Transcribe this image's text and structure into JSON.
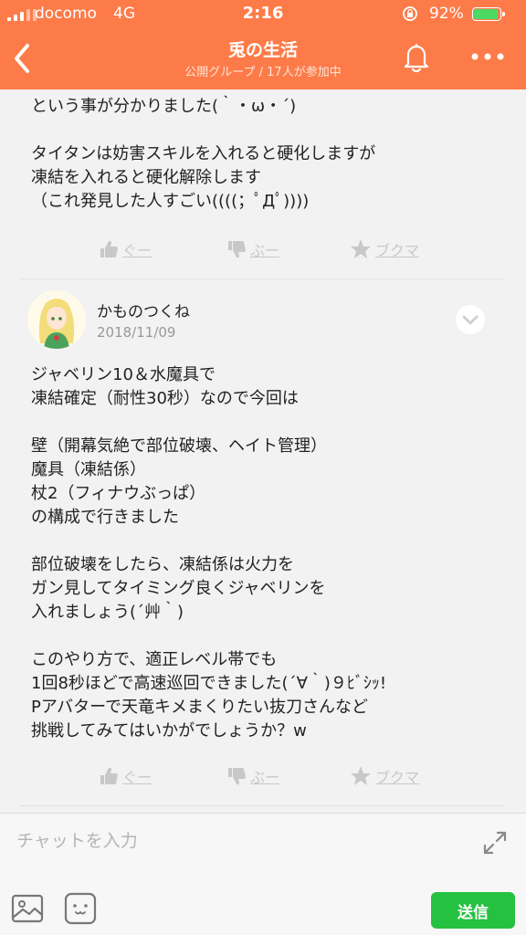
{
  "status": {
    "carrier": "docomo",
    "network": "4G",
    "time": "2:16",
    "battery": "92%",
    "battery_level": 0.92
  },
  "header": {
    "title": "兎の生活",
    "subtitle": "公開グループ / 17人が参加中"
  },
  "posts": [
    {
      "text": "という事が分かりました(｀・ω・´)\n\nタイタンは妨害スキルを入れると硬化しますが\n凍結を入れると硬化解除します\n（これ発見した人すごい((((；ﾟДﾟ))))",
      "actions": {
        "good": "ぐー",
        "bad": "ぶー",
        "bookmark": "ブクマ"
      }
    },
    {
      "author": "かものつくね",
      "date": "2018/11/09",
      "text": "ジャベリン10＆水魔具で\n凍結確定（耐性30秒）なので今回は\n\n壁（開幕気絶で部位破壊、ヘイト管理）\n魔具（凍結係）\n杖2（フィナウぶっぱ）\nの構成で行きました\n\n部位破壊をしたら、凍結係は火力を\nガン見してタイミング良くジャベリンを\n入れましょう(´艸｀)\n\nこのやり方で、適正レベル帯でも\n1回8秒ほどで高速巡回できました(´∀｀)９ﾋﾞｼｯ!\nPアバターで天竜キメまくりたい抜刀さんなど\n挑戦してみてはいかがでしょうか？w",
      "actions": {
        "good": "ぐー",
        "bad": "ぶー",
        "bookmark": "ブクマ"
      }
    }
  ],
  "input": {
    "placeholder": "チャットを入力",
    "send_label": "送信"
  },
  "colors": {
    "accent": "#fd7b48",
    "send": "#25c140"
  }
}
